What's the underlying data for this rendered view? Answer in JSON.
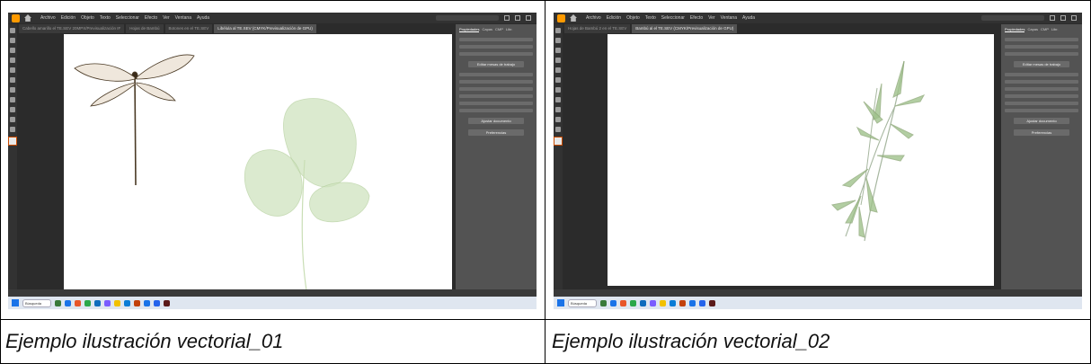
{
  "captions": {
    "left": "Ejemplo ilustración vectorial_01",
    "right": "Ejemplo ilustración vectorial_02"
  },
  "app": {
    "name": "Adobe Illustrator",
    "menus": [
      "Archivo",
      "Edición",
      "Objeto",
      "Texto",
      "Seleccionar",
      "Efecto",
      "Ver",
      "Ventana",
      "Ayuda"
    ],
    "accent_color": "#ff9a00"
  },
  "screens": [
    {
      "tabs": [
        "Cabello amarillo el TE.SEV 20MPX/Previsualización IF",
        "Hojas de Bambú",
        "Botones en el TE.SEV",
        "Libélula al TE.SEV (CMYK/Previsualización de GPU)"
      ],
      "artwork": "dragonfly-and-leaf"
    },
    {
      "tabs": [
        "Hojas de Bambú 2 en el TE.SEV",
        "Bambú al el TE.SEV (CMYK/Previsualización de GPU)"
      ],
      "artwork": "bamboo-leaves"
    }
  ],
  "panel": {
    "tabs": [
      "Propiedades",
      "Capas",
      "CMP",
      "Libr."
    ],
    "buttons": [
      "Editar mesas de trabajo",
      "Ajustar documento",
      "Preferencias"
    ]
  },
  "taskbar": {
    "search_label": "Búsqueda",
    "icon_colors": [
      "#3a7a3a",
      "#1a73e8",
      "#e8562a",
      "#2ba84a",
      "#0f6cbd",
      "#7a5cff",
      "#f2c100",
      "#0a7cd6",
      "#c2410c",
      "#1a73e8",
      "#2563eb",
      "#5b1a1a"
    ]
  }
}
